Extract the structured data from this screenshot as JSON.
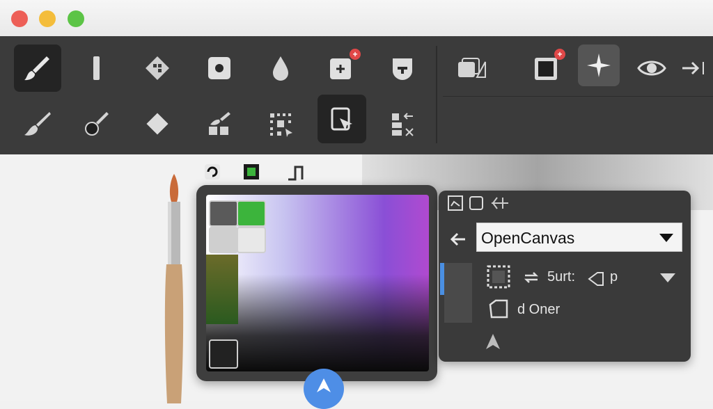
{
  "window": {
    "traffic_lights": [
      "close",
      "minimize",
      "zoom"
    ]
  },
  "toolbar": {
    "row1": [
      {
        "icon": "paintbrush-icon",
        "active": true
      },
      {
        "icon": "smudge-stick-icon"
      },
      {
        "icon": "pattern-diamond-icon"
      },
      {
        "icon": "stamp-circle-icon"
      },
      {
        "icon": "drop-icon"
      },
      {
        "icon": "add-layer-icon",
        "badge": "+"
      },
      {
        "icon": "mask-icon"
      },
      {
        "icon": "layers-stack-icon"
      },
      {
        "icon": "canvas-layer-icon",
        "badge": "+"
      },
      {
        "icon": "sparkle-icon",
        "selected": true
      },
      {
        "icon": "eye-icon"
      },
      {
        "icon": "arrow-right-icon"
      }
    ],
    "row2": [
      {
        "icon": "soft-brush-icon"
      },
      {
        "icon": "ink-brush-icon"
      },
      {
        "icon": "diamond-icon"
      },
      {
        "icon": "fill-brush-icon"
      },
      {
        "icon": "selection-grid-icon"
      },
      {
        "icon": "transform-icon",
        "active": true
      },
      {
        "icon": "arrange-icon"
      }
    ]
  },
  "color_picker": {
    "swatches": [
      "#5a5a5a",
      "#3cb43c",
      "#cfcfcf",
      "#e8e8e8",
      "#222222"
    ]
  },
  "panel": {
    "canvas_select": "OpenCanvas",
    "row1_text": "5urt:",
    "row1_suffix": "p",
    "row2_text": "d Oner"
  },
  "colors": {
    "accent": "#4e8ee6",
    "toolbar_bg": "#3b3b3b",
    "panel_bg": "#3a3a3a",
    "badge": "#e04848"
  }
}
